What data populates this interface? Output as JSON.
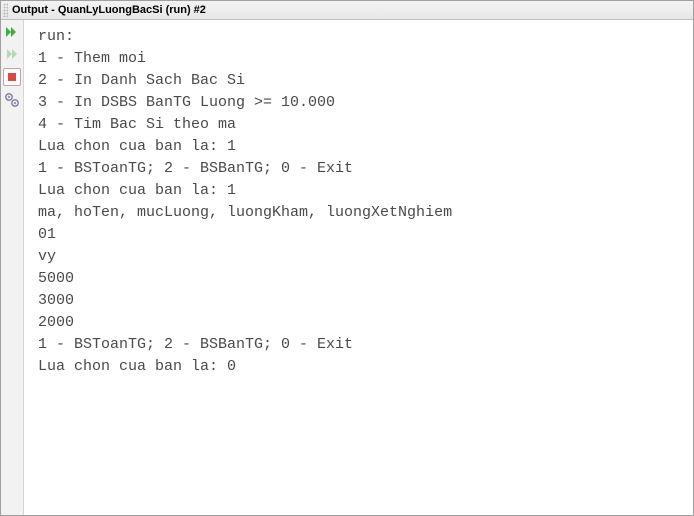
{
  "title": "Output - QuanLyLuongBacSi (run) #2",
  "icons": {
    "run_twice": "run-again-icon",
    "run_once": "run-icon",
    "stop": "stop-icon",
    "settings": "settings-icon"
  },
  "console_lines": [
    "run:",
    "1 - Them moi",
    "2 - In Danh Sach Bac Si",
    "3 - In DSBS BanTG Luong >= 10.000",
    "4 - Tim Bac Si theo ma",
    "Lua chon cua ban la: 1",
    "1 - BSToanTG; 2 - BSBanTG; 0 - Exit",
    "Lua chon cua ban la: 1",
    "ma, hoTen, mucLuong, luongKham, luongXetNghiem",
    "01",
    "vy",
    "5000",
    "3000",
    "2000",
    "1 - BSToanTG; 2 - BSBanTG; 0 - Exit",
    "Lua chon cua ban la: 0"
  ]
}
